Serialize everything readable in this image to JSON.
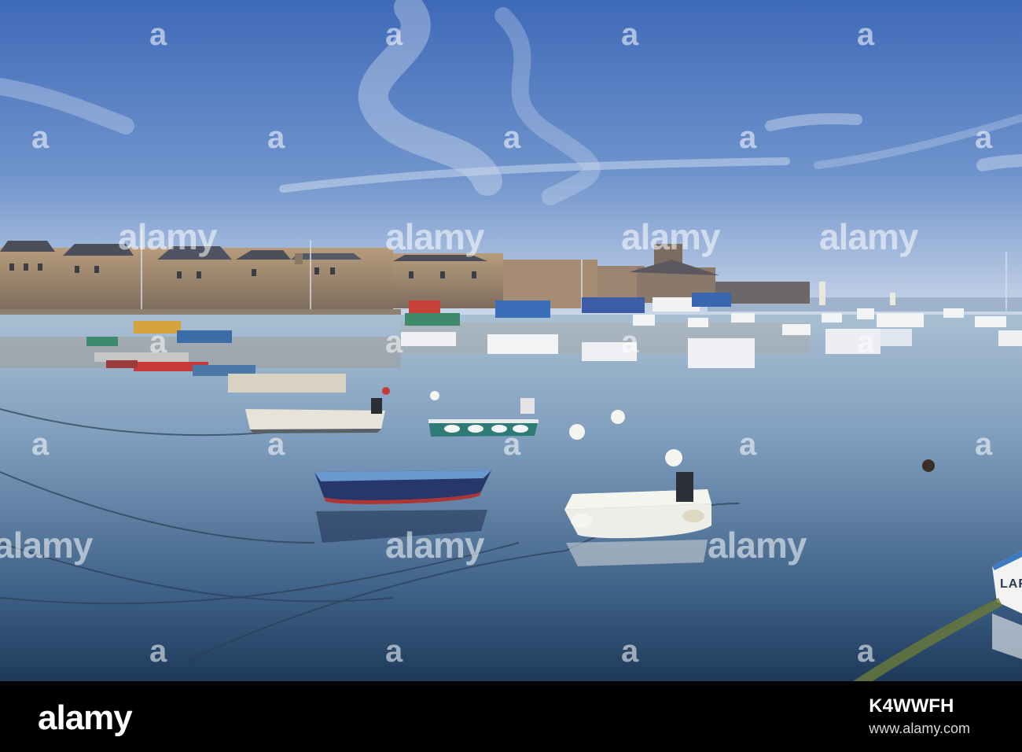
{
  "watermark": {
    "brand": "alamy"
  },
  "scene": {
    "boat_name_visible": "LAF"
  },
  "footer": {
    "logo_text": "alamy",
    "image_id": "K4WWFH",
    "url": "www.alamy.com"
  },
  "colors": {
    "sky_top": "#3f6ab8",
    "sky_horizon": "#c9d6e8",
    "water_top": "#a9bfd3",
    "water_bottom": "#1e3a5a",
    "footer_bg": "#000000"
  }
}
